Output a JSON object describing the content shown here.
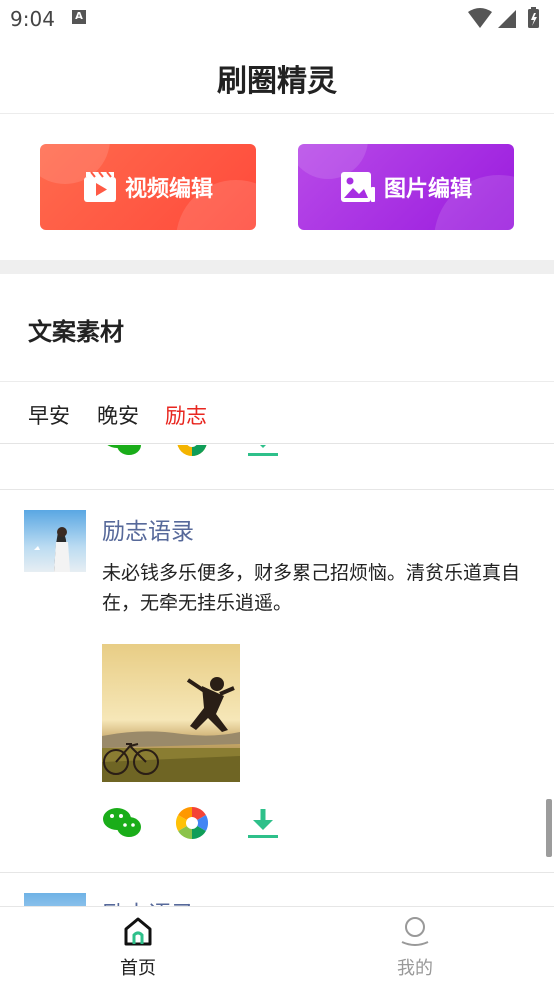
{
  "status_bar": {
    "time": "9:04",
    "a_label": "A"
  },
  "header": {
    "title": "刷圈精灵"
  },
  "buttons": {
    "video_label": "视频编辑",
    "image_label": "图片编辑"
  },
  "section": {
    "title": "文案素材"
  },
  "tabs": [
    {
      "label": "早安",
      "active": false
    },
    {
      "label": "晚安",
      "active": false
    },
    {
      "label": "励志",
      "active": true
    }
  ],
  "posts": [
    {
      "title": "励志语录",
      "body": "未必钱多乐便多，财多累己招烦恼。清贫乐道真自在，无牵无挂乐逍遥。"
    },
    {
      "title": "励志语录"
    }
  ],
  "bottom_nav": {
    "home_label": "首页",
    "mine_label": "我的"
  },
  "colors": {
    "active_tab": "#e8261f",
    "post_title": "#57699a",
    "video_button": "#ff5240",
    "image_button": "#a72ee2",
    "download_green": "#2ec08a",
    "wechat_green": "#1aad19"
  },
  "icons": [
    "wechat-icon",
    "moments-icon",
    "download-icon",
    "home-icon",
    "user-icon",
    "video-icon",
    "image-icon"
  ]
}
